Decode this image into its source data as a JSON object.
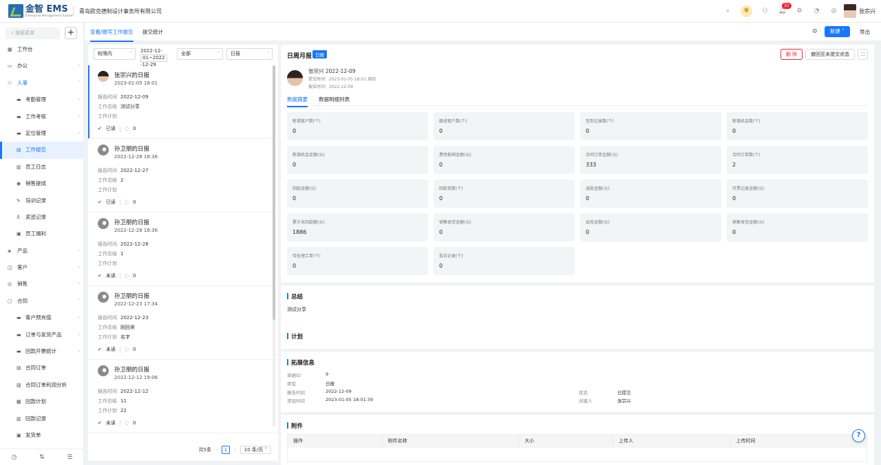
{
  "app": {
    "logo_text": "金智 EMS",
    "logo_sub": "Enterprise Management System",
    "company": "青岛欧克德制设计事务所有限公司",
    "notification_count": "32",
    "user_name": "张宗兴"
  },
  "sidebar": {
    "search_placeholder": "搜索菜单",
    "add_label": "+",
    "items": [
      {
        "label": "工作台",
        "level": "top",
        "icon": "dashboard-icon"
      },
      {
        "label": "办公",
        "level": "top",
        "icon": "office-icon",
        "arrow": "›"
      },
      {
        "label": "人事",
        "level": "top",
        "icon": "people-icon",
        "arrow": "˅",
        "state": "expanded"
      },
      {
        "label": "考勤管理",
        "level": "sub",
        "icon": "folder-icon",
        "arrow": "›"
      },
      {
        "label": "工作考核",
        "level": "sub",
        "icon": "folder-icon",
        "arrow": "›"
      },
      {
        "label": "定位管理",
        "level": "sub",
        "icon": "folder-icon",
        "arrow": "›"
      },
      {
        "label": "工作报告",
        "level": "sub",
        "icon": "report-icon",
        "state": "active"
      },
      {
        "label": "员工日志",
        "level": "sub",
        "icon": "log-icon"
      },
      {
        "label": "销售提成",
        "level": "sub",
        "icon": "commission-icon"
      },
      {
        "label": "培训记录",
        "level": "sub",
        "icon": "training-icon"
      },
      {
        "label": "奖惩记录",
        "level": "sub",
        "icon": "award-icon"
      },
      {
        "label": "员工福利",
        "level": "sub",
        "icon": "welfare-icon"
      },
      {
        "label": "产品",
        "level": "top",
        "icon": "product-icon",
        "arrow": "›"
      },
      {
        "label": "客户",
        "level": "top",
        "icon": "customer-icon",
        "arrow": "›"
      },
      {
        "label": "销售",
        "level": "top",
        "icon": "sales-icon",
        "arrow": "›"
      },
      {
        "label": "合同",
        "level": "top",
        "icon": "contract-icon",
        "arrow": "˅"
      },
      {
        "label": "客户预充值",
        "level": "sub",
        "icon": "folder-icon",
        "arrow": "›"
      },
      {
        "label": "订单与发货产品",
        "level": "sub",
        "icon": "folder-icon",
        "arrow": "›"
      },
      {
        "label": "回款开票统计",
        "level": "sub",
        "icon": "folder-icon",
        "arrow": "›"
      },
      {
        "label": "合同订单",
        "level": "sub",
        "icon": "order-icon"
      },
      {
        "label": "合同订单利润分析",
        "level": "sub",
        "icon": "analysis-icon"
      },
      {
        "label": "回款计划",
        "level": "sub",
        "icon": "plan-icon"
      },
      {
        "label": "回款记录",
        "level": "sub",
        "icon": "record-icon"
      },
      {
        "label": "发货单",
        "level": "sub",
        "icon": "shipping-icon"
      }
    ]
  },
  "tabs": {
    "view_write": "查看/撰写工作报告",
    "stats": "提交统计",
    "new_btn": "新建",
    "export_btn": "导出"
  },
  "filters": {
    "scope": "权限内",
    "date_range": [
      "2022-12-",
      "01~2022",
      "-12-29"
    ],
    "status": "全部",
    "type": "日报"
  },
  "reports": [
    {
      "title": "张宗兴的日报",
      "time": "2023-01-05 18:01",
      "report_date": "2022-12-09",
      "summary": "测试分享",
      "plan": "",
      "read_status": "已读",
      "comments": "0",
      "avatar": "me"
    },
    {
      "title": "孙卫朋的日报",
      "time": "2022-12-28 18:36",
      "report_date": "2022-12-27",
      "summary": "2",
      "plan": "",
      "read_status": "已读",
      "comments": "0",
      "avatar": "gray"
    },
    {
      "title": "孙卫朋的日报",
      "time": "2022-12-28 18:36",
      "report_date": "2022-12-28",
      "summary": "1",
      "plan": "",
      "read_status": "未读",
      "comments": "0",
      "avatar": "gray"
    },
    {
      "title": "孙卫朋的日报",
      "time": "2022-12-23 17:34",
      "report_date": "2022-12-23",
      "summary": "刚回来",
      "plan": "名字",
      "read_status": "未读",
      "comments": "0",
      "avatar": "gray"
    },
    {
      "title": "孙卫朋的日报",
      "time": "2022-12-12 19:06",
      "report_date": "2022-12-12",
      "summary": "11",
      "plan": "22",
      "read_status": "未读",
      "comments": "0",
      "avatar": "gray"
    }
  ],
  "labels": {
    "report_time": "报告时间",
    "summary": "工作总结",
    "plan": "工作计划",
    "submit_time": "提交时间：",
    "report_time_colon": "报告时间："
  },
  "pager": {
    "total": "共5条",
    "page": "1",
    "page_size": "10 条/页"
  },
  "detail": {
    "title": "日周月报",
    "type_tag": "日报",
    "delete_btn": "删 除",
    "withdraw_btn": "撤回至未提交状态",
    "author_line": "张宗兴 2022-12-09",
    "submit_time": "2023-01-05 18:01 周四",
    "report_time": "2022-12-09",
    "tab_summary": "数据摘要",
    "tab_detail": "数据明细列表",
    "stats": [
      {
        "label": "新增客户数(个)",
        "value": "0"
      },
      {
        "label": "跟进客户数(个)",
        "value": "0"
      },
      {
        "label": "签到记录数(个)",
        "value": "0"
      },
      {
        "label": "新增机会数(个)",
        "value": "0"
      },
      {
        "label": "新增机会金额(元)",
        "value": "0"
      },
      {
        "label": "费用报销金额(元)",
        "value": "0"
      },
      {
        "label": "合同订单金额(元)",
        "value": "333"
      },
      {
        "label": "合同订单数(个)",
        "value": "2"
      },
      {
        "label": "回款金额(元)",
        "value": "0"
      },
      {
        "label": "回款单数(个)",
        "value": "0"
      },
      {
        "label": "退款金额(元)",
        "value": "0"
      },
      {
        "label": "开票记录金额(元)",
        "value": "0"
      },
      {
        "label": "累计未回款额(元)",
        "value": "1886"
      },
      {
        "label": "销售退货金额(元)",
        "value": "0"
      },
      {
        "label": "出库金额(元)",
        "value": "0"
      },
      {
        "label": "销售发货金额(元)",
        "value": "0"
      },
      {
        "label": "待处理工单(个)",
        "value": "0"
      },
      {
        "label": "投诉记录(个)",
        "value": "0"
      }
    ],
    "summary_title": "总结",
    "summary_text": "测试分享",
    "plan_title": "计划",
    "ext_title": "拓展信息",
    "ext": {
      "id_label": "单据ID",
      "id": "9",
      "type_label": "类型",
      "type": "日报",
      "rt_label": "报告时间",
      "rt": "2022-12-09",
      "add_label": "添加时间",
      "add": "2023-01-05 18:01:39",
      "status_label": "状态",
      "status": "已提交",
      "creator_label": "创建人",
      "creator": "张宗兴"
    },
    "attach_title": "附件",
    "attach_cols": [
      "操作",
      "附件名称",
      "大小",
      "上传人",
      "上传时间"
    ]
  }
}
